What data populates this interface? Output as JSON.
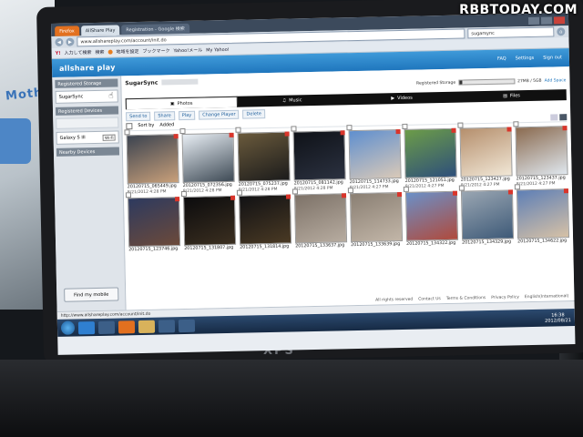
{
  "watermark": "RBBTODAY.COM",
  "laptop_brand": "XPS",
  "desk_text": "Mothe",
  "browser": {
    "tabs": [
      "Firefox",
      "AllShare Play",
      "Registration - Google 検索"
    ],
    "url": "www.allshareplay.com/account/init.do",
    "search_value": "sugarsync",
    "bookmarks": [
      "Y!",
      "入力して検索",
      "検索",
      "地域を設定",
      "ブックマーク",
      "Yahoo!メール",
      "My Yahoo!"
    ]
  },
  "app": {
    "logo": "allshare play",
    "header_links": [
      "FAQ",
      "Settings",
      "Sign out"
    ],
    "sidebar": {
      "registered_storage": "Registered Storage",
      "storage_item": "SugarSync",
      "registered_devices": "Registered Devices",
      "device_item": "Galaxy S III",
      "device_badge": "Wi-Fi",
      "nearby_devices": "Nearby Devices",
      "find_button": "Find my mobile"
    },
    "device_title": "SugarSync",
    "storage": {
      "label": "Registered Storage",
      "used": "27MB / 5GB",
      "used_fraction": 0.05,
      "upgrade": "Add Space"
    },
    "category_tabs": [
      "Photos",
      "Music",
      "Videos",
      "Files"
    ],
    "toolbar": [
      "Send to",
      "Share",
      "Play",
      "Change Player",
      "Delete"
    ],
    "sort_label": "Sort by",
    "sort_value": "Added",
    "photos": [
      {
        "name": "20120715_065449.jpg",
        "date": "8/21/2012 4:28 PM",
        "c1": "#3b4350",
        "c2": "#c9a07a"
      },
      {
        "name": "20120715_072356.jpg",
        "date": "8/21/2012 4:28 PM",
        "c1": "#e8eef4",
        "c2": "#3e4a55"
      },
      {
        "name": "20120715_075237.jpg",
        "date": "8/21/2012 4:28 PM",
        "c1": "#6a5a3c",
        "c2": "#1b1b1b"
      },
      {
        "name": "20120715_081142.jpg",
        "date": "8/21/2012 4:28 PM",
        "c1": "#0f1218",
        "c2": "#2b3140"
      },
      {
        "name": "20120715_114733.jpg",
        "date": "8/21/2012 4:27 PM",
        "c1": "#5f8fcf",
        "c2": "#d9c9b8"
      },
      {
        "name": "20120715_121051.jpg",
        "date": "8/21/2012 4:27 PM",
        "c1": "#6c9c48",
        "c2": "#2e4f7a"
      },
      {
        "name": "20120715_123427.jpg",
        "date": "8/21/2012 4:27 PM",
        "c1": "#b58f6d",
        "c2": "#f1e7d6"
      },
      {
        "name": "20120715_123437.jpg",
        "date": "8/21/2012 4:27 PM",
        "c1": "#8a6a4f",
        "c2": "#dfe7ee"
      },
      {
        "name": "20120715_123746.jpg",
        "date": "",
        "c1": "#2d3a5f",
        "c2": "#6c4a3a"
      },
      {
        "name": "20120715_131807.jpg",
        "date": "",
        "c1": "#0b0b0d",
        "c2": "#3b2f20"
      },
      {
        "name": "20120715_131814.jpg",
        "date": "",
        "c1": "#111114",
        "c2": "#4a3a24"
      },
      {
        "name": "20120715_133637.jpg",
        "date": "",
        "c1": "#7d7268",
        "c2": "#b7aca0"
      },
      {
        "name": "20120715_133639.jpg",
        "date": "",
        "c1": "#8a7f73",
        "c2": "#c2b6a8"
      },
      {
        "name": "20120715_134322.jpg",
        "date": "",
        "c1": "#6a90c8",
        "c2": "#b04a3c"
      },
      {
        "name": "20120715_134329.jpg",
        "date": "",
        "c1": "#9aa6b2",
        "c2": "#3e5a78"
      },
      {
        "name": "20120715_134622.jpg",
        "date": "",
        "c1": "#5e7fb6",
        "c2": "#d6c1a6"
      }
    ],
    "footer_links": [
      "Contact Us",
      "Terms & Conditions",
      "Privacy Policy",
      "English(International)"
    ],
    "copyright": "All rights reserved"
  },
  "statusbar": {
    "url": "http://www.allshareplay.com/account/init.do"
  },
  "taskbar": {
    "time": "16:38",
    "date": "2012/08/21"
  }
}
